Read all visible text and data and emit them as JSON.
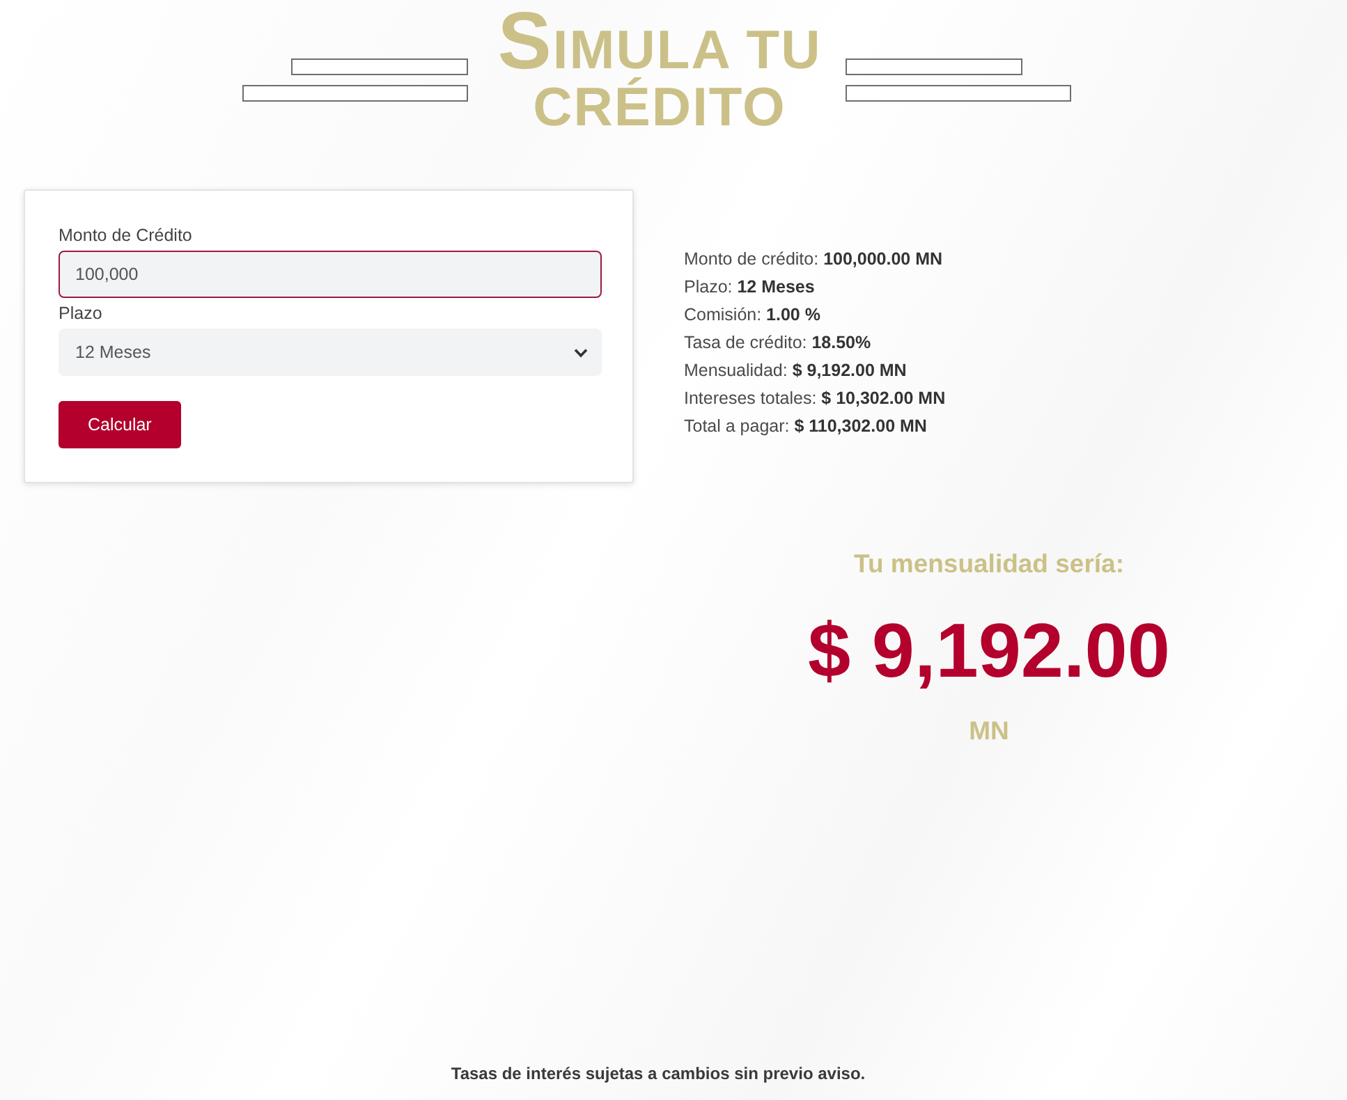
{
  "header": {
    "title": "SIMULA TU CRÉDITO"
  },
  "form": {
    "fields": [
      {
        "kind": "input",
        "label": "Monto de Crédito",
        "value": "100,000",
        "focused": true
      },
      {
        "kind": "select",
        "label": "Plazo",
        "value": "12 Meses"
      }
    ],
    "button": "Calcular"
  },
  "summary": [
    "Monto de crédito: **100,000.00 MN**",
    "Plazo: **12 Meses**",
    "Comisión: **1.00 %**",
    "Tasa de crédito: **18.50%**",
    "Mensualidad: **$ 9,192.00 MN**",
    "Intereses totales: **$ 10,302.00 MN**",
    "Total a pagar: **$ 110,302.00 MN**"
  ],
  "result": {
    "heading": "Tu mensualidad sería:",
    "amount": "$ 9,192.00",
    "currency": "MN"
  },
  "footer": "Tasas de interés sujetas a cambios sin previo aviso."
}
